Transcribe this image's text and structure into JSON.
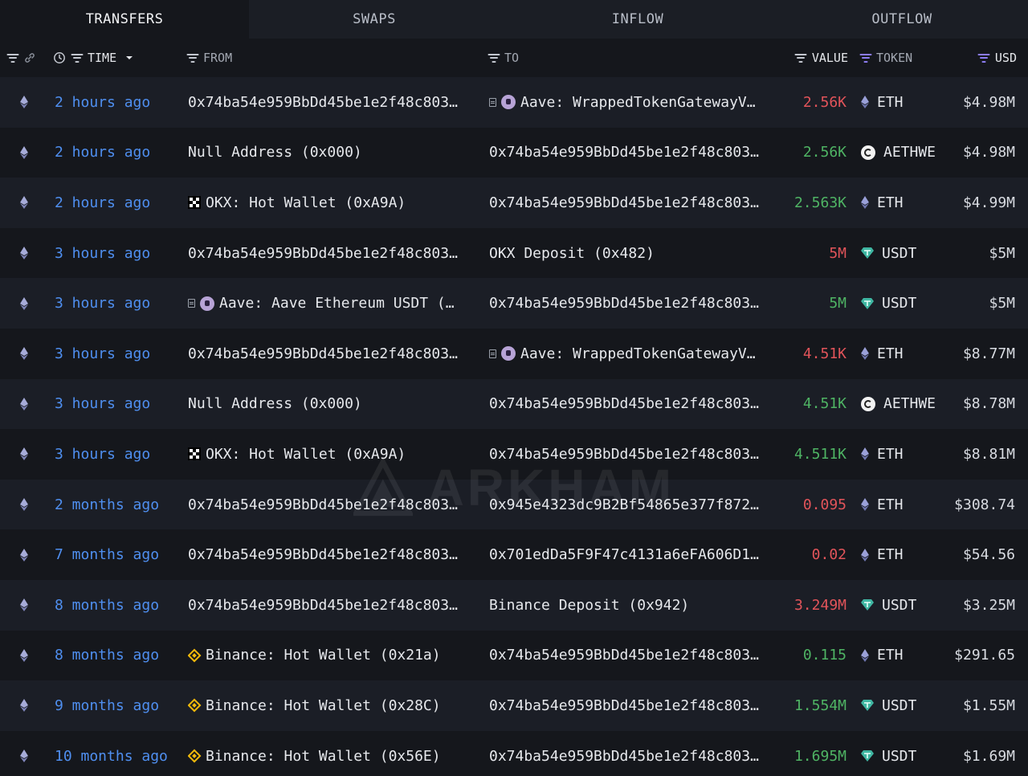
{
  "tabs": [
    {
      "label": "TRANSFERS",
      "active": true
    },
    {
      "label": "SWAPS",
      "active": false
    },
    {
      "label": "INFLOW",
      "active": false
    },
    {
      "label": "OUTFLOW",
      "active": false
    }
  ],
  "columns": {
    "time": "TIME",
    "from": "FROM",
    "to": "TO",
    "value": "VALUE",
    "token": "TOKEN",
    "usd": "USD"
  },
  "watermark": "ARKHAM",
  "colors": {
    "accent_blue": "#4f8ff0",
    "outflow_red": "#e2545a",
    "inflow_green": "#4fb464",
    "filter_purple": "#8c7cf0"
  },
  "rows": [
    {
      "time": "2 hours ago",
      "from": {
        "text": "0x74ba54e959BbDd45be1e2f48c803…",
        "icon": ""
      },
      "to": {
        "text": "Aave: WrappedTokenGatewayV…",
        "icon": "aave"
      },
      "value": "2.56K",
      "dir": "neg",
      "token": "ETH",
      "token_icon": "eth",
      "usd": "$4.98M"
    },
    {
      "time": "2 hours ago",
      "from": {
        "text": "Null Address (0x000)",
        "icon": ""
      },
      "to": {
        "text": "0x74ba54e959BbDd45be1e2f48c803…",
        "icon": ""
      },
      "value": "2.56K",
      "dir": "pos",
      "token": "AETHWE",
      "token_icon": "aethwe",
      "usd": "$4.98M"
    },
    {
      "time": "2 hours ago",
      "from": {
        "text": "OKX: Hot Wallet (0xA9A)",
        "icon": "okx"
      },
      "to": {
        "text": "0x74ba54e959BbDd45be1e2f48c803…",
        "icon": ""
      },
      "value": "2.563K",
      "dir": "pos",
      "token": "ETH",
      "token_icon": "eth",
      "usd": "$4.99M"
    },
    {
      "time": "3 hours ago",
      "from": {
        "text": "0x74ba54e959BbDd45be1e2f48c803…",
        "icon": ""
      },
      "to": {
        "text": "OKX Deposit (0x482)",
        "icon": ""
      },
      "value": "5M",
      "dir": "neg",
      "token": "USDT",
      "token_icon": "usdt",
      "usd": "$5M"
    },
    {
      "time": "3 hours ago",
      "from": {
        "text": "Aave: Aave Ethereum USDT (…",
        "icon": "aave"
      },
      "to": {
        "text": "0x74ba54e959BbDd45be1e2f48c803…",
        "icon": ""
      },
      "value": "5M",
      "dir": "pos",
      "token": "USDT",
      "token_icon": "usdt",
      "usd": "$5M"
    },
    {
      "time": "3 hours ago",
      "from": {
        "text": "0x74ba54e959BbDd45be1e2f48c803…",
        "icon": ""
      },
      "to": {
        "text": "Aave: WrappedTokenGatewayV…",
        "icon": "aave"
      },
      "value": "4.51K",
      "dir": "neg",
      "token": "ETH",
      "token_icon": "eth",
      "usd": "$8.77M"
    },
    {
      "time": "3 hours ago",
      "from": {
        "text": "Null Address (0x000)",
        "icon": ""
      },
      "to": {
        "text": "0x74ba54e959BbDd45be1e2f48c803…",
        "icon": ""
      },
      "value": "4.51K",
      "dir": "pos",
      "token": "AETHWE",
      "token_icon": "aethwe",
      "usd": "$8.78M"
    },
    {
      "time": "3 hours ago",
      "from": {
        "text": "OKX: Hot Wallet (0xA9A)",
        "icon": "okx"
      },
      "to": {
        "text": "0x74ba54e959BbDd45be1e2f48c803…",
        "icon": ""
      },
      "value": "4.511K",
      "dir": "pos",
      "token": "ETH",
      "token_icon": "eth",
      "usd": "$8.81M"
    },
    {
      "time": "2 months ago",
      "from": {
        "text": "0x74ba54e959BbDd45be1e2f48c803…",
        "icon": ""
      },
      "to": {
        "text": "0x945e4323dc9B2Bf54865e377f872…",
        "icon": ""
      },
      "value": "0.095",
      "dir": "neg",
      "token": "ETH",
      "token_icon": "eth",
      "usd": "$308.74"
    },
    {
      "time": "7 months ago",
      "from": {
        "text": "0x74ba54e959BbDd45be1e2f48c803…",
        "icon": ""
      },
      "to": {
        "text": "0x701edDa5F9F47c4131a6eFA606D1…",
        "icon": ""
      },
      "value": "0.02",
      "dir": "neg",
      "token": "ETH",
      "token_icon": "eth",
      "usd": "$54.56"
    },
    {
      "time": "8 months ago",
      "from": {
        "text": "0x74ba54e959BbDd45be1e2f48c803…",
        "icon": ""
      },
      "to": {
        "text": "Binance Deposit (0x942)",
        "icon": ""
      },
      "value": "3.249M",
      "dir": "neg",
      "token": "USDT",
      "token_icon": "usdt",
      "usd": "$3.25M"
    },
    {
      "time": "8 months ago",
      "from": {
        "text": "Binance: Hot Wallet (0x21a)",
        "icon": "binance"
      },
      "to": {
        "text": "0x74ba54e959BbDd45be1e2f48c803…",
        "icon": ""
      },
      "value": "0.115",
      "dir": "pos",
      "token": "ETH",
      "token_icon": "eth",
      "usd": "$291.65"
    },
    {
      "time": "9 months ago",
      "from": {
        "text": "Binance: Hot Wallet (0x28C)",
        "icon": "binance"
      },
      "to": {
        "text": "0x74ba54e959BbDd45be1e2f48c803…",
        "icon": ""
      },
      "value": "1.554M",
      "dir": "pos",
      "token": "USDT",
      "token_icon": "usdt",
      "usd": "$1.55M"
    },
    {
      "time": "10 months ago",
      "from": {
        "text": "Binance: Hot Wallet (0x56E)",
        "icon": "binance"
      },
      "to": {
        "text": "0x74ba54e959BbDd45be1e2f48c803…",
        "icon": ""
      },
      "value": "1.695M",
      "dir": "pos",
      "token": "USDT",
      "token_icon": "usdt",
      "usd": "$1.69M"
    }
  ]
}
